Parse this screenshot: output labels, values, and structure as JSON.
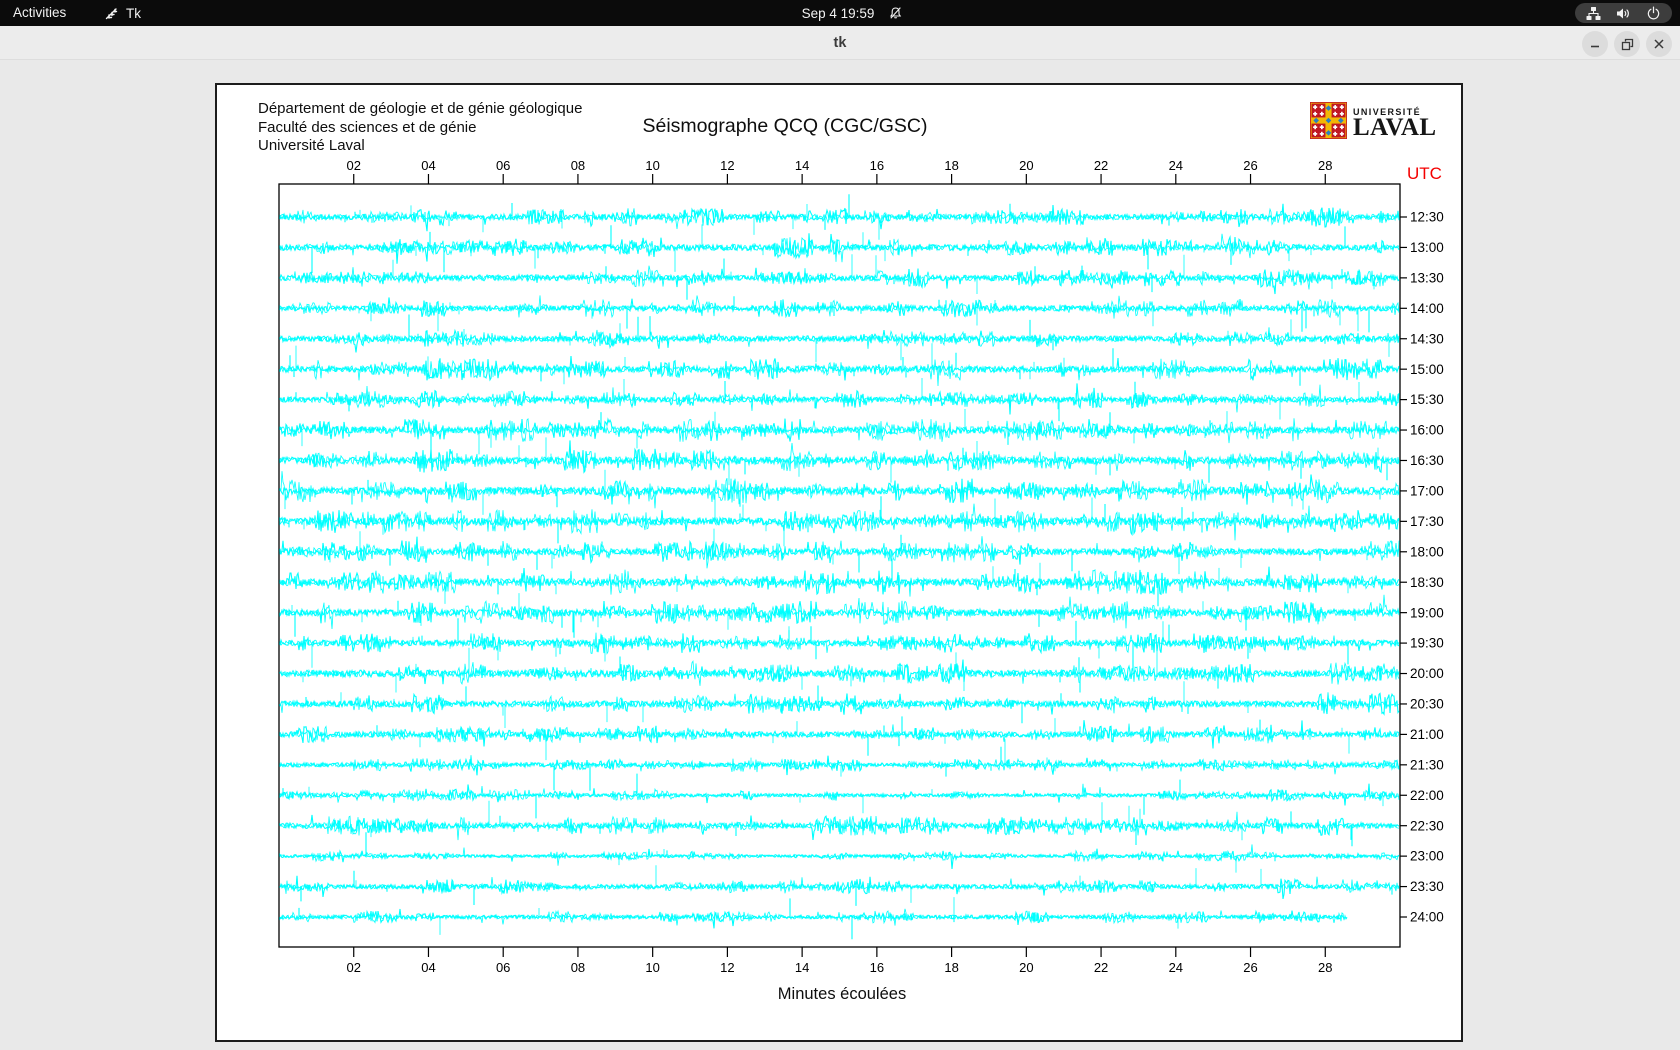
{
  "top_bar": {
    "activities_label": "Activities",
    "app_label": "Tk",
    "clock": "Sep 4  19:59",
    "icons": [
      "tk-icon",
      "bell-slash-icon",
      "network-icon",
      "volume-icon",
      "power-icon"
    ]
  },
  "window": {
    "title": "tk",
    "controls": [
      "minimize",
      "maximize",
      "close"
    ]
  },
  "canvas": {
    "header_lines": [
      "Département de géologie et de génie géologique",
      "Faculté des sciences et de génie",
      "Université Laval"
    ],
    "title": "Séismographe QCQ (CGC/GSC)",
    "logo": {
      "line1": "UNIVERSITÉ",
      "line2": "LAVAL"
    },
    "utc_label": "UTC",
    "xlabel": "Minutes écoulées"
  },
  "chart_data": {
    "type": "line",
    "subtype": "helicorder-seismogram",
    "title": "Séismographe QCQ (CGC/GSC)",
    "xlabel": "Minutes écoulées",
    "right_axis_label": "UTC",
    "x_ticks": [
      "02",
      "04",
      "06",
      "08",
      "10",
      "12",
      "14",
      "16",
      "18",
      "20",
      "22",
      "24",
      "26",
      "28"
    ],
    "x_range_minutes": [
      0,
      30
    ],
    "grid": false,
    "trace_color": "#00ffff",
    "axis_color": "#000000",
    "utc_label_color": "#f40000",
    "traces": [
      {
        "utc": "12:30",
        "amp": 1.5,
        "spikes": 22,
        "end_minute": 30,
        "seed": 1
      },
      {
        "utc": "13:00",
        "amp": 1.6,
        "spikes": 26,
        "end_minute": 30,
        "seed": 2
      },
      {
        "utc": "13:30",
        "amp": 1.5,
        "spikes": 20,
        "end_minute": 30,
        "seed": 3
      },
      {
        "utc": "14:00",
        "amp": 1.4,
        "spikes": 22,
        "end_minute": 30,
        "seed": 4
      },
      {
        "utc": "14:30",
        "amp": 1.5,
        "spikes": 20,
        "end_minute": 30,
        "seed": 5
      },
      {
        "utc": "15:00",
        "amp": 1.7,
        "spikes": 22,
        "end_minute": 30,
        "seed": 6
      },
      {
        "utc": "15:30",
        "amp": 1.4,
        "spikes": 18,
        "end_minute": 30,
        "seed": 7
      },
      {
        "utc": "16:00",
        "amp": 1.8,
        "spikes": 24,
        "end_minute": 30,
        "seed": 8
      },
      {
        "utc": "16:30",
        "amp": 1.9,
        "spikes": 26,
        "end_minute": 30,
        "seed": 9
      },
      {
        "utc": "17:00",
        "amp": 2.0,
        "spikes": 28,
        "end_minute": 30,
        "seed": 10
      },
      {
        "utc": "17:30",
        "amp": 2.0,
        "spikes": 26,
        "end_minute": 30,
        "seed": 11
      },
      {
        "utc": "18:00",
        "amp": 1.7,
        "spikes": 24,
        "end_minute": 30,
        "seed": 12
      },
      {
        "utc": "18:30",
        "amp": 1.9,
        "spikes": 26,
        "end_minute": 30,
        "seed": 13
      },
      {
        "utc": "19:00",
        "amp": 1.8,
        "spikes": 28,
        "end_minute": 30,
        "seed": 14
      },
      {
        "utc": "19:30",
        "amp": 1.6,
        "spikes": 22,
        "end_minute": 30,
        "seed": 15
      },
      {
        "utc": "20:00",
        "amp": 1.8,
        "spikes": 26,
        "end_minute": 30,
        "seed": 16
      },
      {
        "utc": "20:30",
        "amp": 1.6,
        "spikes": 22,
        "end_minute": 30,
        "seed": 17
      },
      {
        "utc": "21:00",
        "amp": 1.5,
        "spikes": 20,
        "end_minute": 30,
        "seed": 18
      },
      {
        "utc": "21:30",
        "amp": 1.1,
        "spikes": 14,
        "end_minute": 30,
        "seed": 19
      },
      {
        "utc": "22:00",
        "amp": 0.9,
        "spikes": 12,
        "end_minute": 30,
        "seed": 20
      },
      {
        "utc": "22:30",
        "amp": 1.5,
        "spikes": 20,
        "end_minute": 30,
        "seed": 21
      },
      {
        "utc": "23:00",
        "amp": 0.8,
        "spikes": 9,
        "end_minute": 30,
        "seed": 22
      },
      {
        "utc": "23:30",
        "amp": 1.2,
        "spikes": 14,
        "end_minute": 30,
        "seed": 23
      },
      {
        "utc": "24:00",
        "amp": 1.0,
        "spikes": 7,
        "end_minute": 28.6,
        "seed": 24
      }
    ]
  }
}
